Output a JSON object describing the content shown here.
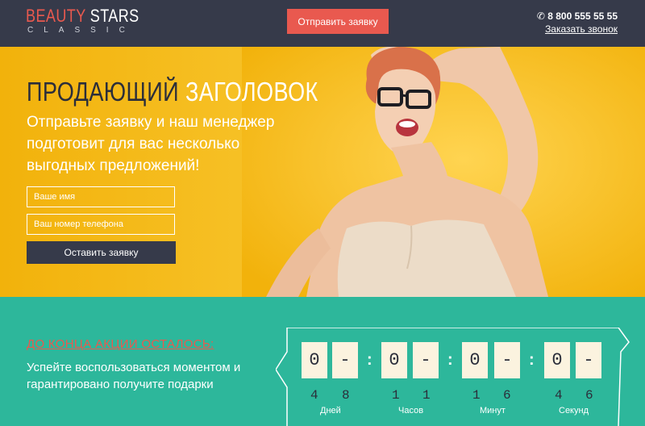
{
  "header": {
    "logo_word1": "BEAUTY",
    "logo_word2": "STARS",
    "logo_sub": "CLASSIC",
    "cta_label": "Отправить заявку",
    "phone": "8 800 555 55 55",
    "callback_label": "Заказать звонок"
  },
  "hero": {
    "title_dark": "ПРОДАЮЩИЙ",
    "title_white": "ЗАГОЛОВОК",
    "subtitle": "Отправьте заявку и наш менеджер подготовит для вас несколько выгодных предложений!",
    "name_placeholder": "Ваше имя",
    "phone_placeholder": "Ваш номер телефона",
    "submit_label": "Оставить заявку"
  },
  "countdown": {
    "title": "ДО КОНЦА АКЦИИ ОСТАЛОСЬ:",
    "subtitle": "Успейте воспользоваться моментом и гарантировано получите подарки",
    "digits": [
      "0",
      "-",
      "0",
      "-",
      "0",
      "-",
      "0",
      "-"
    ],
    "separator": ":",
    "numbers": [
      "4",
      "8",
      "1",
      "1",
      "1",
      "6",
      "4",
      "6"
    ],
    "units": [
      "Дней",
      "Часов",
      "Минут",
      "Секунд"
    ]
  },
  "colors": {
    "header_bg": "#363a4a",
    "accent_red": "#e9594f",
    "hero_yellow": "#f5bd1f",
    "teal": "#2db79b"
  }
}
